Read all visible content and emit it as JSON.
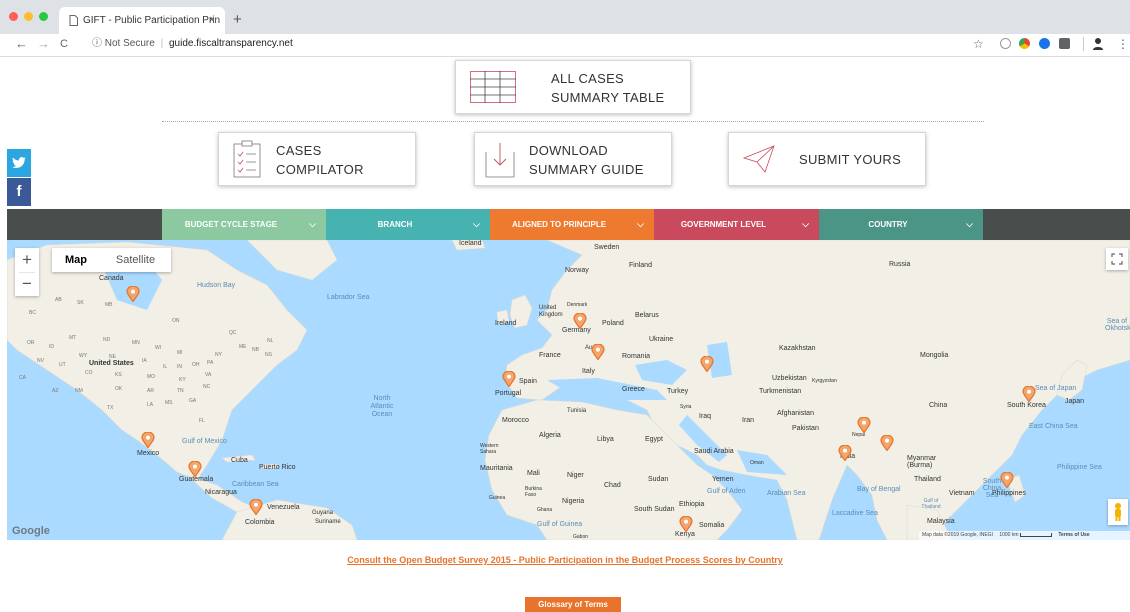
{
  "browser": {
    "tab_title": "GIFT - Public Participation Prin",
    "tab_close": "×",
    "new_tab": "+",
    "back": "←",
    "forward": "→",
    "reload": "C",
    "security": "ⓘ Not Secure",
    "separator": "|",
    "url": "guide.fiscaltransparency.net",
    "star": "☆"
  },
  "header": {
    "summary_table": {
      "line1": "ALL CASES",
      "line2": "SUMMARY TABLE"
    },
    "cases_compilator": {
      "line1": "CASES",
      "line2": "COMPILATOR"
    },
    "download_guide": {
      "line1": "DOWNLOAD",
      "line2": "SUMMARY GUIDE"
    },
    "submit": {
      "label": "SUBMIT YOURS"
    }
  },
  "social": {
    "twitter": "🐦",
    "facebook": "f"
  },
  "filters": [
    {
      "label": "BUDGET CYCLE STAGE",
      "color": "#8cc9a0"
    },
    {
      "label": "BRANCH",
      "color": "#47b3b0"
    },
    {
      "label": "ALIGNED TO PRINCIPLE",
      "color": "#ee7a2f"
    },
    {
      "label": "GOVERNMENT LEVEL",
      "color": "#c94a5c"
    },
    {
      "label": "COUNTRY",
      "color": "#4a9585"
    }
  ],
  "filter_chevron": "⌵",
  "map": {
    "zoom_in": "+",
    "zoom_out": "−",
    "type_map": "Map",
    "type_satellite": "Satellite",
    "attribution": "Map data ©2019 Google, INEGI",
    "scale": "1000 km",
    "terms": "Terms of Use",
    "google": "Google",
    "labels": {
      "canada": "Canada",
      "hudson_bay": "Hudson Bay",
      "labrador_sea": "Labrador Sea",
      "united_states": "United States",
      "mexico": "Mexico",
      "gulf_mexico": "Gulf of Mexico",
      "cuba": "Cuba",
      "puerto_rico": "Puerto Rico",
      "guatemala": "Guatemala",
      "nicaragua": "Nicaragua",
      "caribbean": "Caribbean Sea",
      "venezuela": "Venezuela",
      "colombia": "Colombia",
      "guyana": "Guyana",
      "suriname": "Suriname",
      "north_atlantic": "North Atlantic Ocean",
      "iceland": "Iceland",
      "sweden": "Sweden",
      "norway": "Norway",
      "finland": "Finland",
      "united_kingdom": "United Kingdom",
      "denmark": "Denmark",
      "ireland": "Ireland",
      "germany": "Germany",
      "poland": "Poland",
      "belarus": "Belarus",
      "ukraine": "Ukraine",
      "france": "France",
      "austria": "Austria",
      "romania": "Romania",
      "italy": "Italy",
      "spain": "Spain",
      "portugal": "Portugal",
      "greece": "Greece",
      "turkey": "Turkey",
      "tunisia": "Tunisia",
      "morocco": "Morocco",
      "algeria": "Algeria",
      "libya": "Libya",
      "egypt": "Egypt",
      "western_sahara": "Western Sahara",
      "mauritania": "Mauritania",
      "mali": "Mali",
      "niger": "Niger",
      "chad": "Chad",
      "sudan": "Sudan",
      "burkina": "Burkina Faso",
      "guinea": "Guinea",
      "ghana": "Ghana",
      "nigeria": "Nigeria",
      "gulf_guinea": "Gulf of Guinea",
      "south_sudan": "South Sudan",
      "ethiopia": "Ethiopia",
      "somalia": "Somalia",
      "kenya": "Kenya",
      "gabon": "Gabon",
      "syria": "Syria",
      "iraq": "Iraq",
      "iran": "Iran",
      "saudi_arabia": "Saudi Arabia",
      "yemen": "Yemen",
      "oman": "Oman",
      "gulf_aden": "Gulf of Aden",
      "arabian_sea": "Arabian Sea",
      "russia": "Russia",
      "kazakhstan": "Kazakhstan",
      "uzbekistan": "Uzbekistan",
      "kyrgyzstan": "Kyrgyzstan",
      "turkmenistan": "Turkmenistan",
      "afghanistan": "Afghanistan",
      "pakistan": "Pakistan",
      "nepal": "Nepal",
      "india": "India",
      "mongolia": "Mongolia",
      "china": "China",
      "myanmar": "Myanmar (Burma)",
      "thailand": "Thailand",
      "vietnam": "Vietnam",
      "bay_bengal": "Bay of Bengal",
      "laccadive": "Laccadive Sea",
      "malaysia": "Malaysia",
      "south_korea": "South Korea",
      "japan": "Japan",
      "sea_japan": "Sea of Japan",
      "east_china": "East China Sea",
      "south_china": "South China Sea",
      "philippines": "Philippines",
      "philippine_sea": "Philippine Sea",
      "sea_okhotsk": "Sea of Okhotsk",
      "gulf_thailand": "Gulf of Thailand",
      "mn": "MN",
      "wy": "WY",
      "nd": "ND",
      "ne": "NE",
      "co": "CO",
      "ks": "KS",
      "ok": "OK",
      "tx": "TX",
      "az": "AZ",
      "nm": "NM",
      "nv": "NV",
      "ut": "UT",
      "mo": "MO",
      "ar": "AR",
      "ia": "IA",
      "il": "IL",
      "wi": "WI",
      "mi": "MI",
      "on": "ON",
      "qc": "QC",
      "ny": "NY",
      "pa": "PA",
      "va": "VA",
      "ga": "GA",
      "tn": "TN",
      "nc": "NC",
      "ms": "MS",
      "la": "LA",
      "mb": "MB",
      "sk": "SK",
      "ab": "AB",
      "bc": "BC",
      "mt": "MT",
      "or": "OR",
      "id": "ID",
      "ca": "CA",
      "fl": "FL",
      "ky": "KY",
      "in": "IN",
      "oh": "OH",
      "me": "ME",
      "nb": "NB",
      "ns": "NS",
      "nl": "NL"
    }
  },
  "footer": {
    "survey_link": "Consult the Open Budget Survey 2015 - Public Participation in the Budget Process Scores by Country",
    "glossary": "Glossary of Terms"
  }
}
